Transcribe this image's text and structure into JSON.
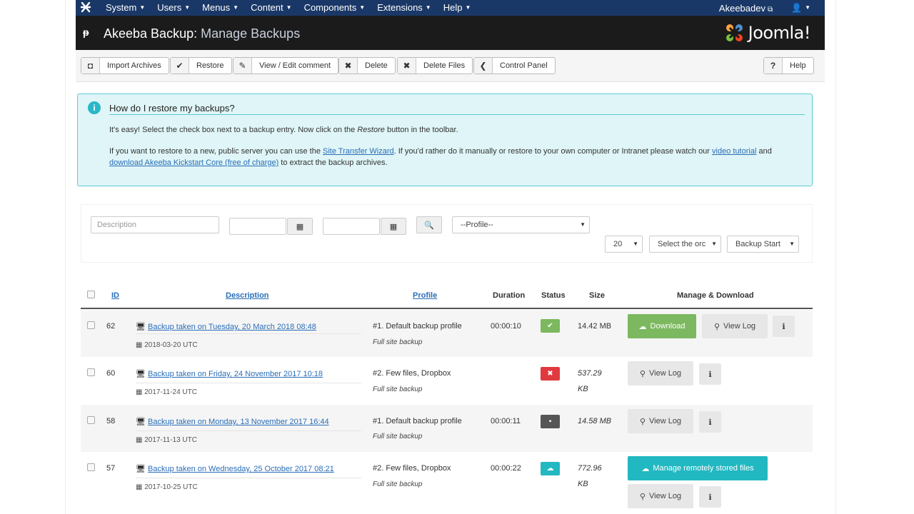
{
  "nav": {
    "menu": [
      "System",
      "Users",
      "Menus",
      "Content",
      "Components",
      "Extensions",
      "Help"
    ],
    "user": "Akeebadev"
  },
  "header": {
    "title_main": "Akeeba Backup:",
    "title_sub": "Manage Backups",
    "brand": "Joomla!"
  },
  "toolbar": {
    "buttons": [
      "Import Archives",
      "Restore",
      "View / Edit comment",
      "Delete",
      "Delete Files",
      "Control Panel"
    ],
    "help": "Help"
  },
  "info": {
    "heading": "How do I restore my backups?",
    "p1_a": "It's easy! Select the check box next to a backup entry. Now click on the ",
    "p1_em": "Restore",
    "p1_b": " button in the toolbar.",
    "p2_a": "If you want to restore to a new, public server you can use the ",
    "p2_link1": "Site Transfer Wizard",
    "p2_b": ". If you'd rather do it manually or restore to your own computer or Intranet please watch our ",
    "p2_link2": "video tutorial",
    "p2_c": " and ",
    "p2_link3": "download Akeeba Kickstart Core (free of charge)",
    "p2_d": " to extract the backup archives."
  },
  "filters": {
    "description_placeholder": "Description",
    "profile": "--Profile--",
    "limit": "20",
    "order": "Select the orc",
    "sort": "Backup Start"
  },
  "table": {
    "headers": {
      "id": "ID",
      "description": "Description",
      "profile": "Profile",
      "duration": "Duration",
      "status": "Status",
      "size": "Size",
      "manage": "Manage & Download"
    },
    "rows": [
      {
        "id": "62",
        "desc": "Backup taken on Tuesday, 20 March 2018 08:48",
        "date": "2018-03-20 UTC",
        "profile": "#1. Default backup profile",
        "type": "Full site backup",
        "duration": "00:00:10",
        "size": "14.42 MB"
      },
      {
        "id": "60",
        "desc": "Backup taken on Friday, 24 November 2017 10:18",
        "date": "2017-11-24 UTC",
        "profile": "#2. Few files, Dropbox",
        "type": "Full site backup",
        "duration": "",
        "size1": "537.29",
        "size2": "KB"
      },
      {
        "id": "58",
        "desc": "Backup taken on Monday, 13 November 2017 16:44",
        "date": "2017-11-13 UTC",
        "profile": "#1. Default backup profile",
        "type": "Full site backup",
        "duration": "00:00:11",
        "size": "14.58 MB"
      },
      {
        "id": "57",
        "desc": "Backup taken on Wednesday, 25 October 2017 08:21",
        "date": "2017-10-25 UTC",
        "profile": "#2. Few files, Dropbox",
        "type": "Full site backup",
        "duration": "00:00:22",
        "size1": "772.96",
        "size2": "KB"
      }
    ],
    "actions": {
      "download": "Download",
      "view_log": "View Log",
      "manage_remote": "Manage remotely stored files"
    }
  },
  "colors": {
    "nav_bg": "#1a3867",
    "header_bg": "#1b1b1b",
    "success": "#7cb85f",
    "danger": "#e0393e",
    "teal": "#22b8c2",
    "link": "#2a6eb8"
  }
}
